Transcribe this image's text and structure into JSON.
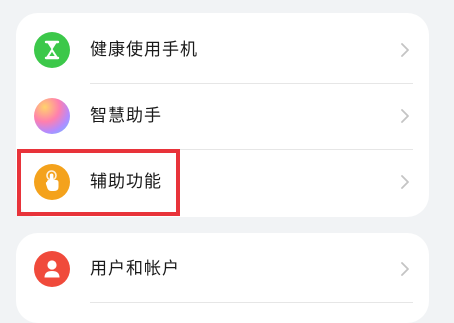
{
  "groups": [
    {
      "items": [
        {
          "label": "健康使用手机",
          "icon": "hourglass-icon",
          "icon_color": "#3cc84a"
        },
        {
          "label": "智慧助手",
          "icon": "assistant-orb-icon",
          "icon_color": "#ff7fae"
        },
        {
          "label": "辅助功能",
          "icon": "hand-touch-icon",
          "icon_color": "#f4a21c",
          "highlighted": true
        }
      ]
    },
    {
      "items": [
        {
          "label": "用户和帐户",
          "icon": "user-icon",
          "icon_color": "#f04a3b"
        }
      ]
    }
  ],
  "highlight_color": "#e8333a"
}
